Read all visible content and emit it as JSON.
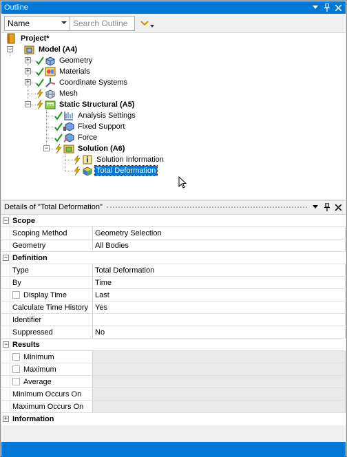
{
  "outline": {
    "title": "Outline",
    "name_combo": "Name",
    "search_placeholder": "Search Outline",
    "tree": {
      "project": "Project*",
      "model": "Model (A4)",
      "geometry": "Geometry",
      "materials": "Materials",
      "coordinate_systems": "Coordinate Systems",
      "mesh": "Mesh",
      "static_structural": "Static Structural (A5)",
      "analysis_settings": "Analysis Settings",
      "fixed_support": "Fixed Support",
      "force": "Force",
      "solution": "Solution (A6)",
      "solution_information": "Solution Information",
      "total_deformation": "Total Deformation"
    }
  },
  "details": {
    "title": "Details of \"Total Deformation\"",
    "sections": {
      "scope": "Scope",
      "definition": "Definition",
      "results": "Results",
      "information": "Information"
    },
    "rows": {
      "scoping_method": {
        "name": "Scoping Method",
        "value": "Geometry Selection"
      },
      "geometry": {
        "name": "Geometry",
        "value": "All Bodies"
      },
      "type": {
        "name": "Type",
        "value": "Total Deformation"
      },
      "by": {
        "name": "By",
        "value": "Time"
      },
      "display_time": {
        "name": "Display Time",
        "value": "Last"
      },
      "calc_time_history": {
        "name": "Calculate Time History",
        "value": "Yes"
      },
      "identifier": {
        "name": "Identifier",
        "value": ""
      },
      "suppressed": {
        "name": "Suppressed",
        "value": "No"
      },
      "minimum": {
        "name": "Minimum",
        "value": ""
      },
      "maximum": {
        "name": "Maximum",
        "value": ""
      },
      "average": {
        "name": "Average",
        "value": ""
      },
      "min_occurs_on": {
        "name": "Minimum Occurs On",
        "value": ""
      },
      "max_occurs_on": {
        "name": "Maximum Occurs On",
        "value": ""
      }
    }
  },
  "colors": {
    "accent": "#0078d7",
    "check_green": "#1a9a1a",
    "lightning_yellow": "#e0b000"
  }
}
